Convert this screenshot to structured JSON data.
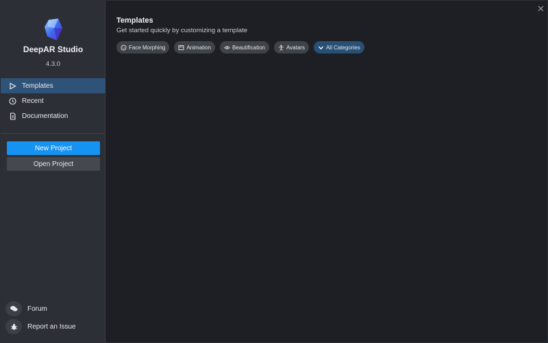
{
  "app": {
    "name": "DeepAR Studio",
    "version": "4.3.0"
  },
  "nav": [
    {
      "label": "Templates",
      "icon": "play-triangle-icon",
      "active": true
    },
    {
      "label": "Recent",
      "icon": "clock-icon",
      "active": false
    },
    {
      "label": "Documentation",
      "icon": "document-icon",
      "active": false
    }
  ],
  "actions": {
    "new_project": "New Project",
    "open_project": "Open Project"
  },
  "footer": {
    "forum": "Forum",
    "report": "Report an Issue"
  },
  "main": {
    "title": "Templates",
    "subtitle": "Get started quickly by customizing a template",
    "chips": [
      {
        "label": "Face Morphing",
        "icon": "face-icon"
      },
      {
        "label": "Animation",
        "icon": "film-icon"
      },
      {
        "label": "Beautification",
        "icon": "eye-icon"
      },
      {
        "label": "Avatars",
        "icon": "person-icon"
      },
      {
        "label": "All Categories",
        "icon": "chevron-down-icon",
        "selected": true
      }
    ]
  },
  "colors": {
    "accent": "#1592f2",
    "active_nav": "#2f5378",
    "sidebar": "#2c2f35",
    "background": "#1d1f24"
  }
}
